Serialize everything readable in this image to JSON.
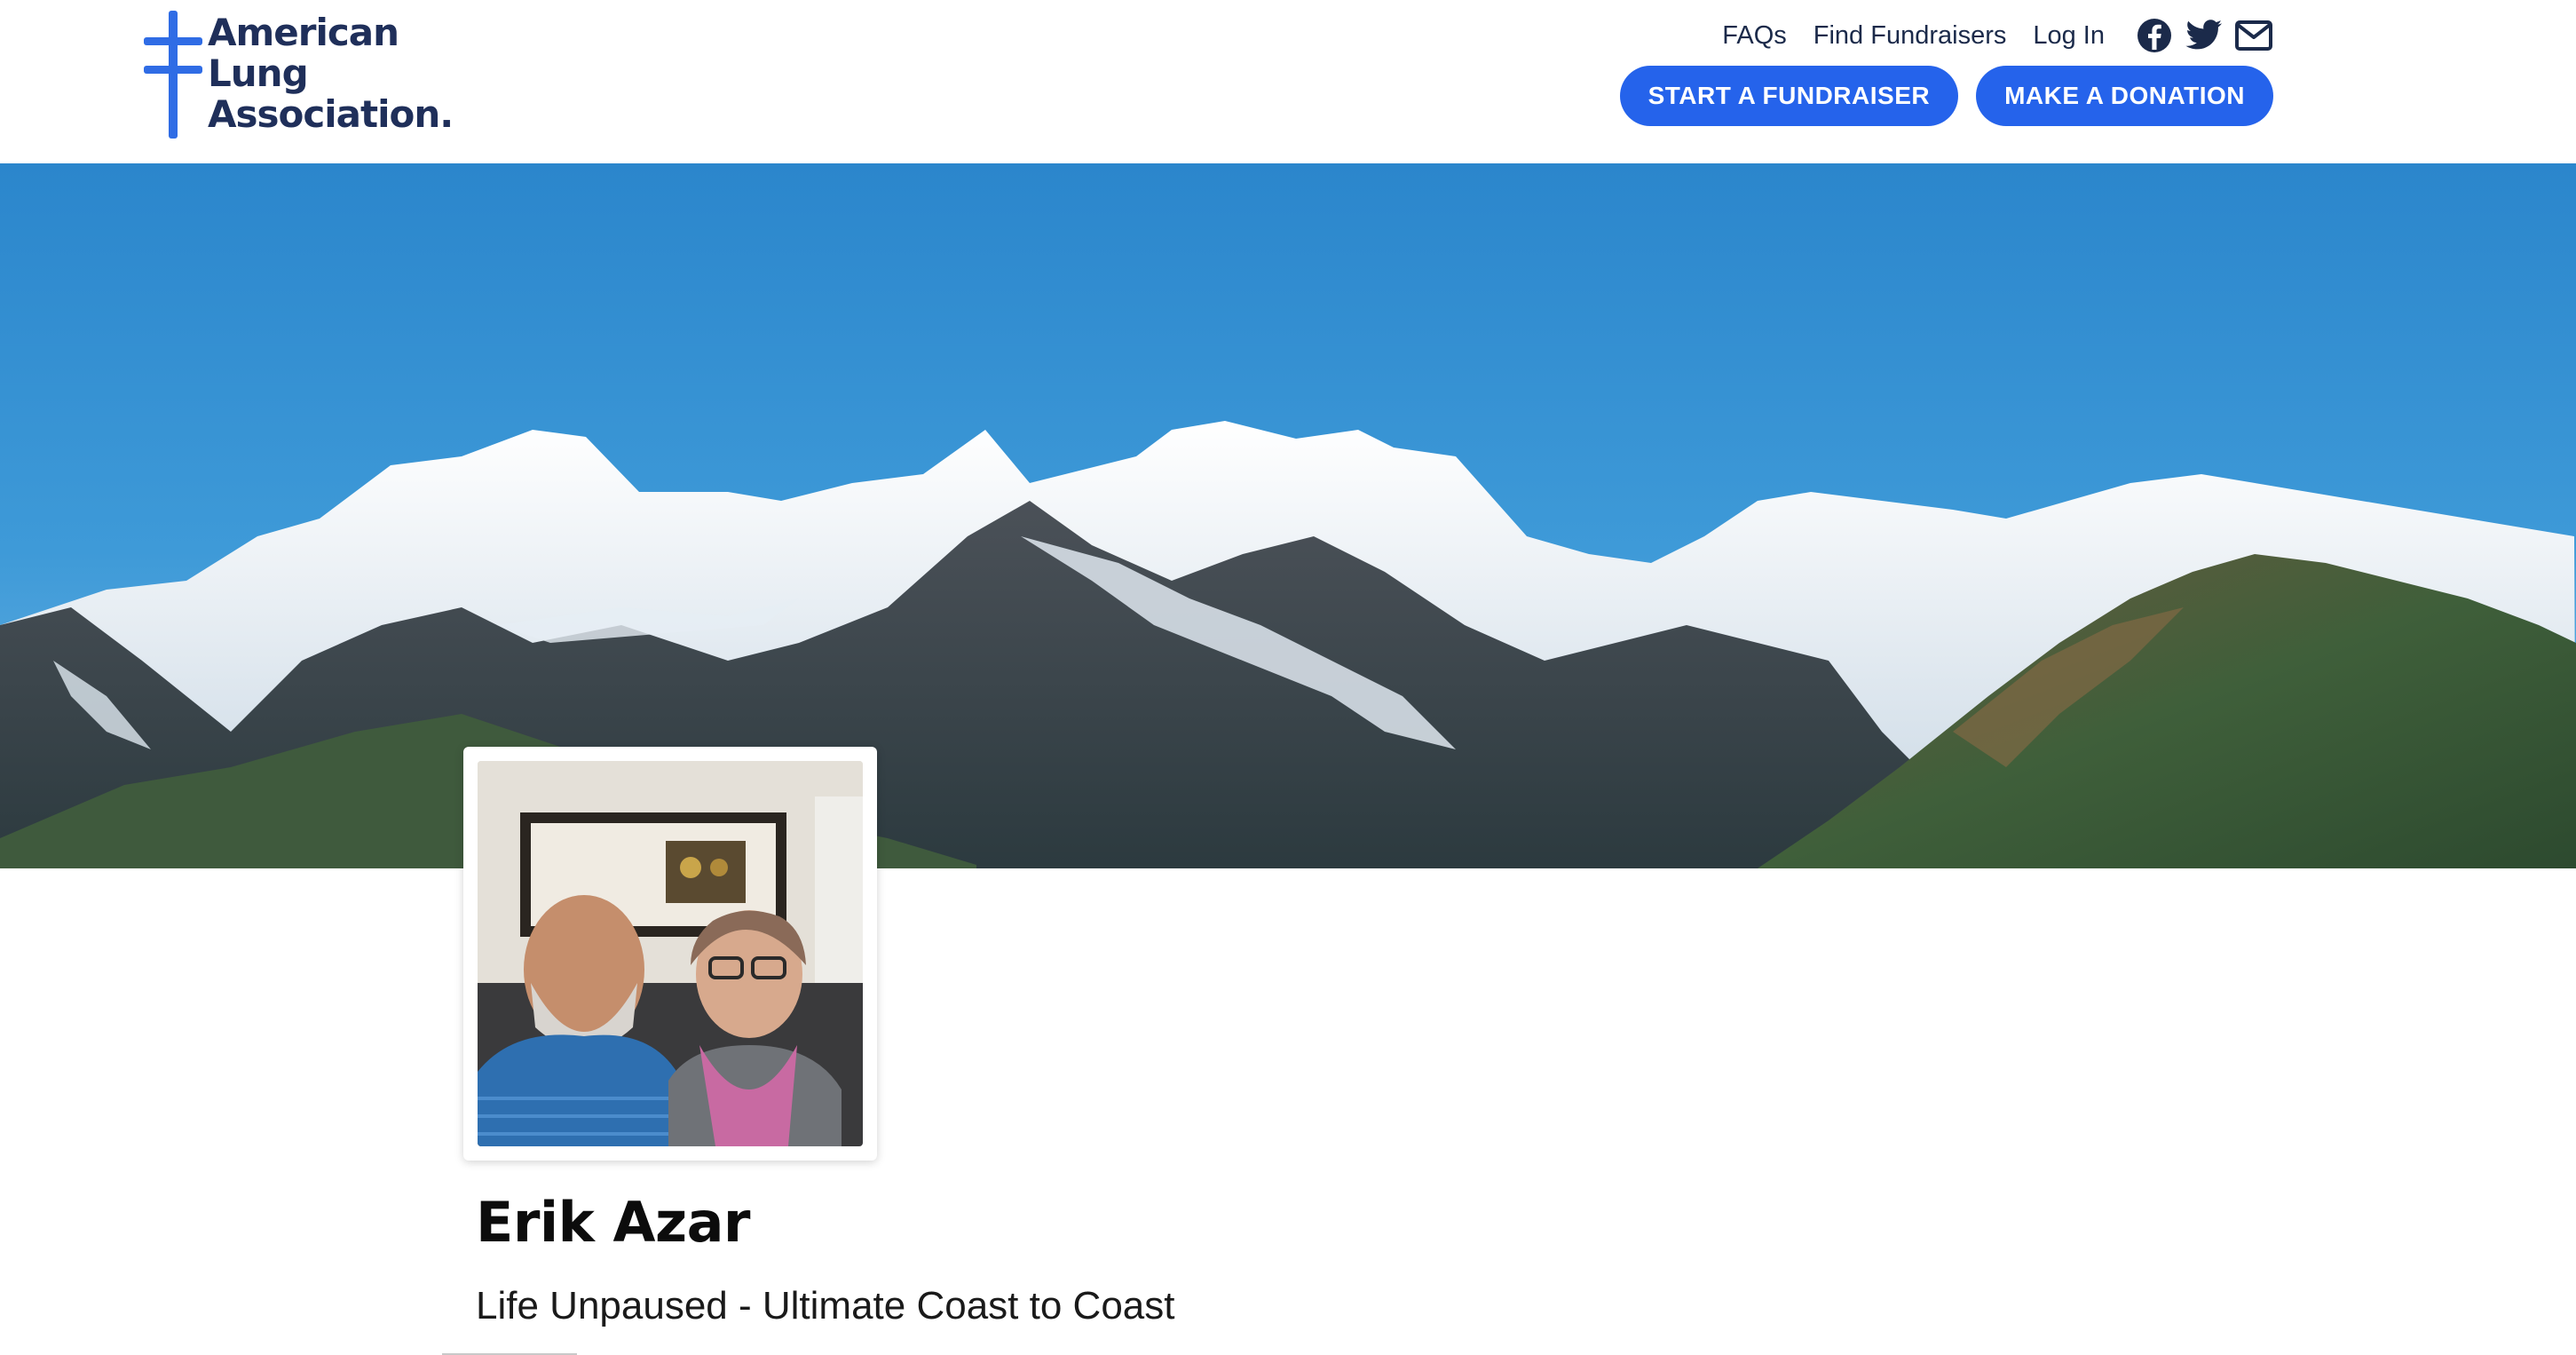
{
  "header": {
    "logo": {
      "line1": "American",
      "line2": "Lung",
      "line3": "Association."
    },
    "links": {
      "faqs": "FAQs",
      "find_fundraisers": "Find Fundraisers",
      "log_in": "Log In"
    },
    "social_icons": [
      "facebook-icon",
      "twitter-icon",
      "mail-icon"
    ],
    "buttons": {
      "start_fundraiser": "START A FUNDRAISER",
      "make_donation": "MAKE A DONATION"
    }
  },
  "banner": {
    "image": "mountain-landscape"
  },
  "profile": {
    "photo": "couple-portrait",
    "name": "Erik Azar",
    "event": "Life Unpaused - Ultimate Coast to Coast"
  },
  "colors": {
    "brand_blue": "#2563eb",
    "logo_navy": "#1f2f5a",
    "logo_cross": "#2f6ce5",
    "text_dark": "#1b2a4a"
  }
}
